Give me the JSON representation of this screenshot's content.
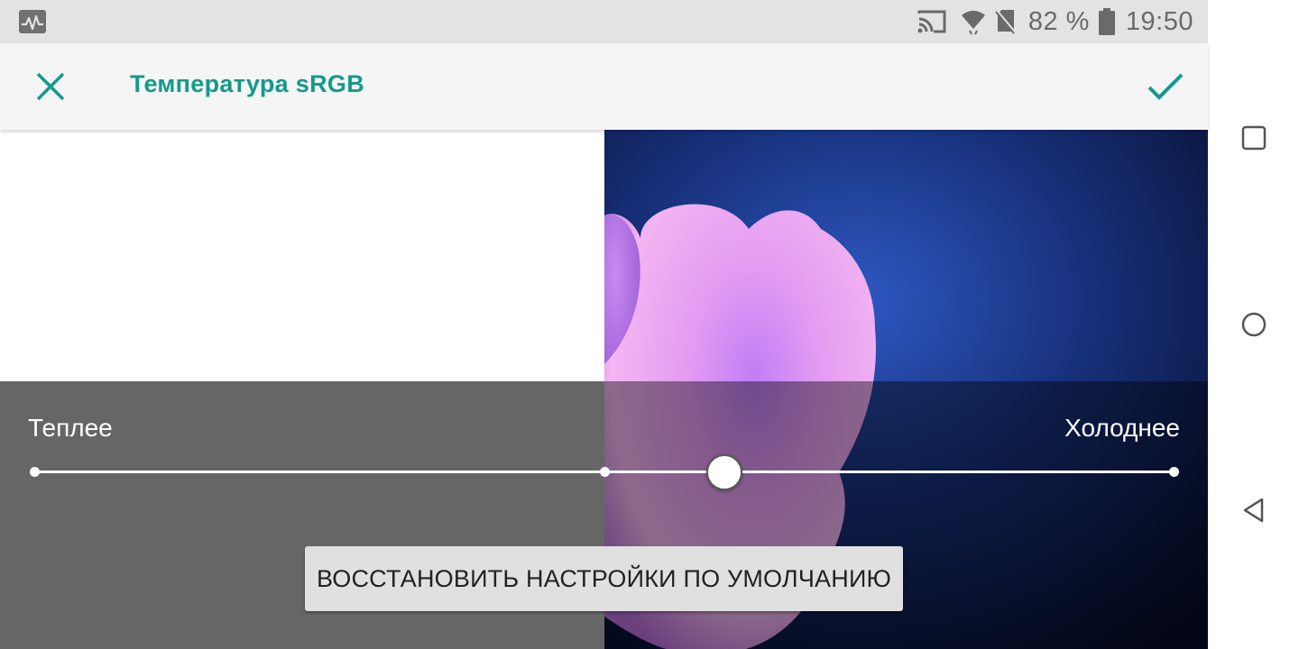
{
  "status_bar": {
    "battery_percent": "82 %",
    "time": "19:50",
    "icons": [
      "activity-icon",
      "cast-icon",
      "wifi-icon",
      "no-sim-icon",
      "battery-icon"
    ]
  },
  "app_bar": {
    "title": "Температура sRGB",
    "close_icon": "close-icon",
    "confirm_icon": "check-icon"
  },
  "controls": {
    "label_warm": "Теплее",
    "label_cool": "Холоднее",
    "slider": {
      "min": 0,
      "max": 1,
      "value": 0.606,
      "stops": [
        0,
        0.5,
        1
      ]
    },
    "reset_label": "ВОССТАНОВИТЬ НАСТРОЙКИ ПО УМОЛЧАНИЮ"
  },
  "nav_bar": {
    "icons": [
      "recent-apps-icon",
      "home-icon",
      "back-icon"
    ]
  },
  "colors": {
    "accent": "#149a8a",
    "status_bar_bg": "#e3e3e3",
    "app_bar_bg": "#f5f5f5",
    "overlay_gray": "#666666"
  }
}
